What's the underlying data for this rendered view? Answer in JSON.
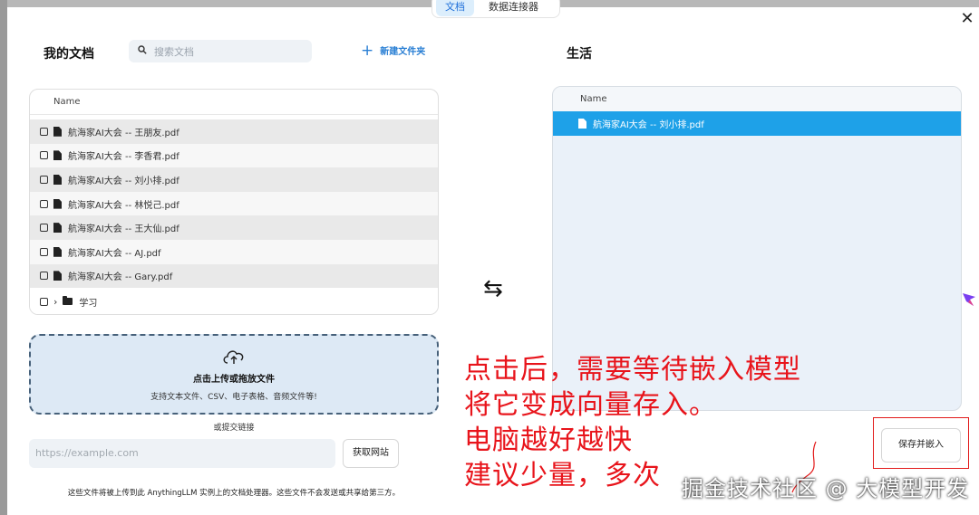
{
  "tabs": {
    "documents": "文档",
    "connectors": "数据连接器"
  },
  "left": {
    "title": "我的文档",
    "search_placeholder": "搜索文档",
    "new_folder": "新建文件夹",
    "column_name": "Name",
    "files": [
      "航海家AI大会 -- 王朋友.pdf",
      "航海家AI大会 -- 李香君.pdf",
      "航海家AI大会 -- 刘小排.pdf",
      "航海家AI大会 -- 林悦己.pdf",
      "航海家AI大会 -- 王大仙.pdf",
      "航海家AI大会 -- AJ.pdf",
      "航海家AI大会 -- Gary.pdf"
    ],
    "folder": "学习",
    "upload_title": "点击上传或拖放文件",
    "upload_sub": "支持文本文件、CSV、电子表格、音频文件等!",
    "or_link": "或提交链接",
    "url_placeholder": "https://example.com",
    "fetch_button": "获取网站",
    "disclaimer": "这些文件将被上传到此 AnythingLLM 实例上的文档处理器。这些文件不会发送或共享给第三方。"
  },
  "right": {
    "title": "生活",
    "column_name": "Name",
    "files": [
      "航海家AI大会 -- 刘小排.pdf"
    ],
    "save_button": "保存并嵌入"
  },
  "annotation": {
    "line1": "点击后，需要等待嵌入模型",
    "line2": "将它变成向量存入。",
    "line3": "电脑越好越快",
    "line4": "建议少量，多次"
  },
  "watermark": "掘金技术社区 @ 大模型开发",
  "icons": {
    "close": "close-icon",
    "search": "search-icon",
    "swap": "swap-arrows-icon",
    "upload": "cloud-upload-icon"
  },
  "colors": {
    "accent": "#1ea1e8",
    "annotation": "#e8141b",
    "link": "#2a7fd4"
  }
}
